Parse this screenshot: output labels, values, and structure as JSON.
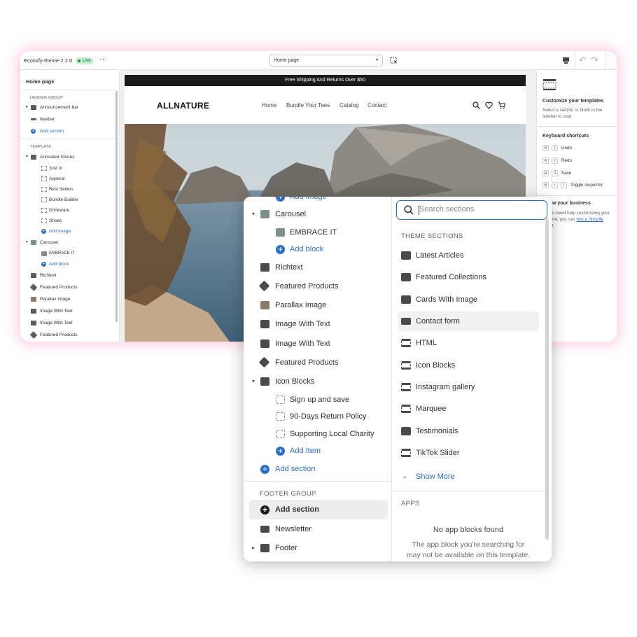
{
  "topbar": {
    "theme_name": "Ecomify-theme-2.2.0",
    "status": "Live",
    "more": "···",
    "page_select": "Home page"
  },
  "sidebar": {
    "title": "Home page",
    "header_group": "HEADER GROUP",
    "header_items": [
      "Announcement bar",
      "Navbar"
    ],
    "add_section": "Add section",
    "template_group": "TEMPLATE",
    "animated_stories": "Animated Stories",
    "animated_children": [
      "Just In",
      "Apperal",
      "Best Sellers",
      "Bundle Builder",
      "Drinkware",
      "Shoes"
    ],
    "add_image": "Add image",
    "carousel": "Carousel",
    "carousel_child": "EMBRACE IT",
    "add_block": "Add block",
    "more_items": [
      "Richtext",
      "Featured Products",
      "Parallax Image",
      "Image With Text",
      "Image With Text",
      "Featured Products"
    ]
  },
  "preview": {
    "announcement": "Free Shipping And Returns Over $50",
    "logo": "ALLNATURE",
    "nav": [
      "Home",
      "Bundle Your Tees",
      "Catalog",
      "Contact"
    ]
  },
  "right_panel": {
    "customize_title": "Customize your templates",
    "customize_desc": "Select a section or block in the sidebar to start.",
    "shortcuts_title": "Keyboard shortcuts",
    "shortcuts": [
      {
        "keys": [
          "⌘",
          "Z"
        ],
        "label": "Undo"
      },
      {
        "keys": [
          "⌘",
          "Y"
        ],
        "label": "Redo"
      },
      {
        "keys": [
          "⌘",
          "S"
        ],
        "label": "Save"
      },
      {
        "keys": [
          "⌘",
          "⇧",
          "I"
        ],
        "label": "Toggle inspector"
      }
    ],
    "business_title": "w your business",
    "business_desc_1": "u need help customizing your",
    "business_desc_2": "ne, you can",
    "business_link": "hire a Shopify",
    "business_desc_3": "t."
  },
  "popup": {
    "left": {
      "add_image_partial": "Add image",
      "carousel": "Carousel",
      "embrace": "EMBRACE IT",
      "add_block": "Add block",
      "items": [
        "Richtext",
        "Featured Products",
        "Parallax Image",
        "Image With Text",
        "Image With Text",
        "Featured Products"
      ],
      "icon_blocks": "Icon Blocks",
      "icon_children": [
        "Sign up and save",
        "90-Days Return Policy",
        "Supporting Local Charity"
      ],
      "add_item": "Add Item",
      "add_section": "Add section",
      "footer_group": "FOOTER GROUP",
      "footer_add_section": "Add section",
      "newsletter": "Newsletter",
      "footer": "Footer"
    },
    "right": {
      "search_placeholder": "Search sections",
      "theme_sections_title": "THEME SECTIONS",
      "sections": [
        "Latest Articles",
        "Featured Collections",
        "Cards With Image",
        "Contact form",
        "HTML",
        "Icon Blocks",
        "Instagram gallery",
        "Marquee",
        "Testimonials",
        "TikTok Slider"
      ],
      "show_more": "Show More",
      "apps_title": "APPS",
      "no_apps": "No app blocks found",
      "apps_desc_1": "The app block you're searching for",
      "apps_desc_2": "may not be available on this template."
    }
  }
}
